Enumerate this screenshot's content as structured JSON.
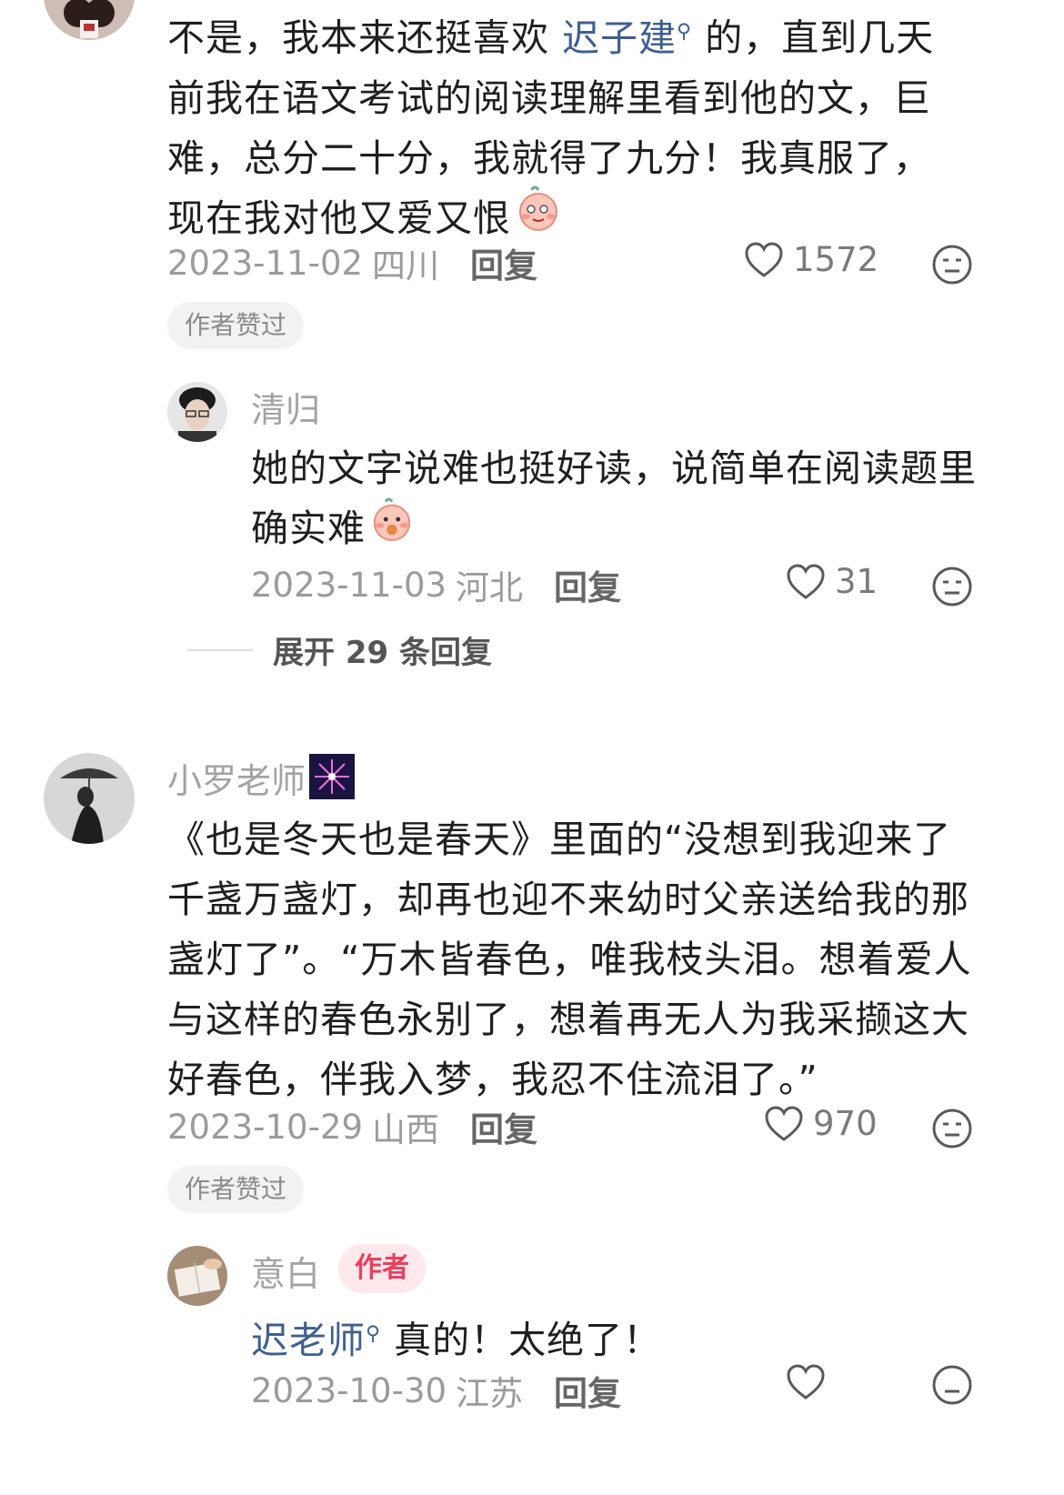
{
  "comments": [
    {
      "text_before": "不是，我本来还挺喜欢 ",
      "mention": "迟子建",
      "text_after": " 的，直到几天前我在语文考试的阅读理解里看到他的文，巨难，总分二十分，我就得了九分！我真服了，现在我对他又爱又恨",
      "date": "2023-11-02",
      "region": "四川",
      "reply_label": "回复",
      "likes": "1572",
      "author_liked": "作者赞过",
      "replies": [
        {
          "username": "清归",
          "text": "她的文字说难也挺好读，说简单在阅读题里确实难",
          "date": "2023-11-03",
          "region": "河北",
          "reply_label": "回复",
          "likes": "31"
        }
      ],
      "expand_label": "展开 29 条回复"
    },
    {
      "username": "小罗老师",
      "text": "《也是冬天也是春天》里面的“没想到我迎来了千盏万盏灯，却再也迎不来幼时父亲送给我的那盏灯了”。“万木皆春色，唯我枝头泪。想着爱人与这样的春色永别了，想着再无人为我采撷这大好春色，伴我入梦，我忍不住流泪了。”",
      "date": "2023-10-29",
      "region": "山西",
      "reply_label": "回复",
      "likes": "970",
      "author_liked": "作者赞过",
      "replies": [
        {
          "username": "意白",
          "badge": "作者",
          "mention": "迟老师",
          "text_after": " 真的！太绝了！",
          "date": "2023-10-30",
          "region": "江苏",
          "reply_label": "回复"
        }
      ]
    }
  ],
  "colors": {
    "mention": "#3f5f90",
    "author_badge_bg": "#fde8ec",
    "author_badge_text": "#ea3f5d",
    "meta_text": "#9b9b9b"
  },
  "icons": {
    "like": "heart-outline-icon",
    "dislike": "neutral-face-icon",
    "emoji": "blushing-peach-emoji",
    "fireworks": "fireworks-icon"
  }
}
